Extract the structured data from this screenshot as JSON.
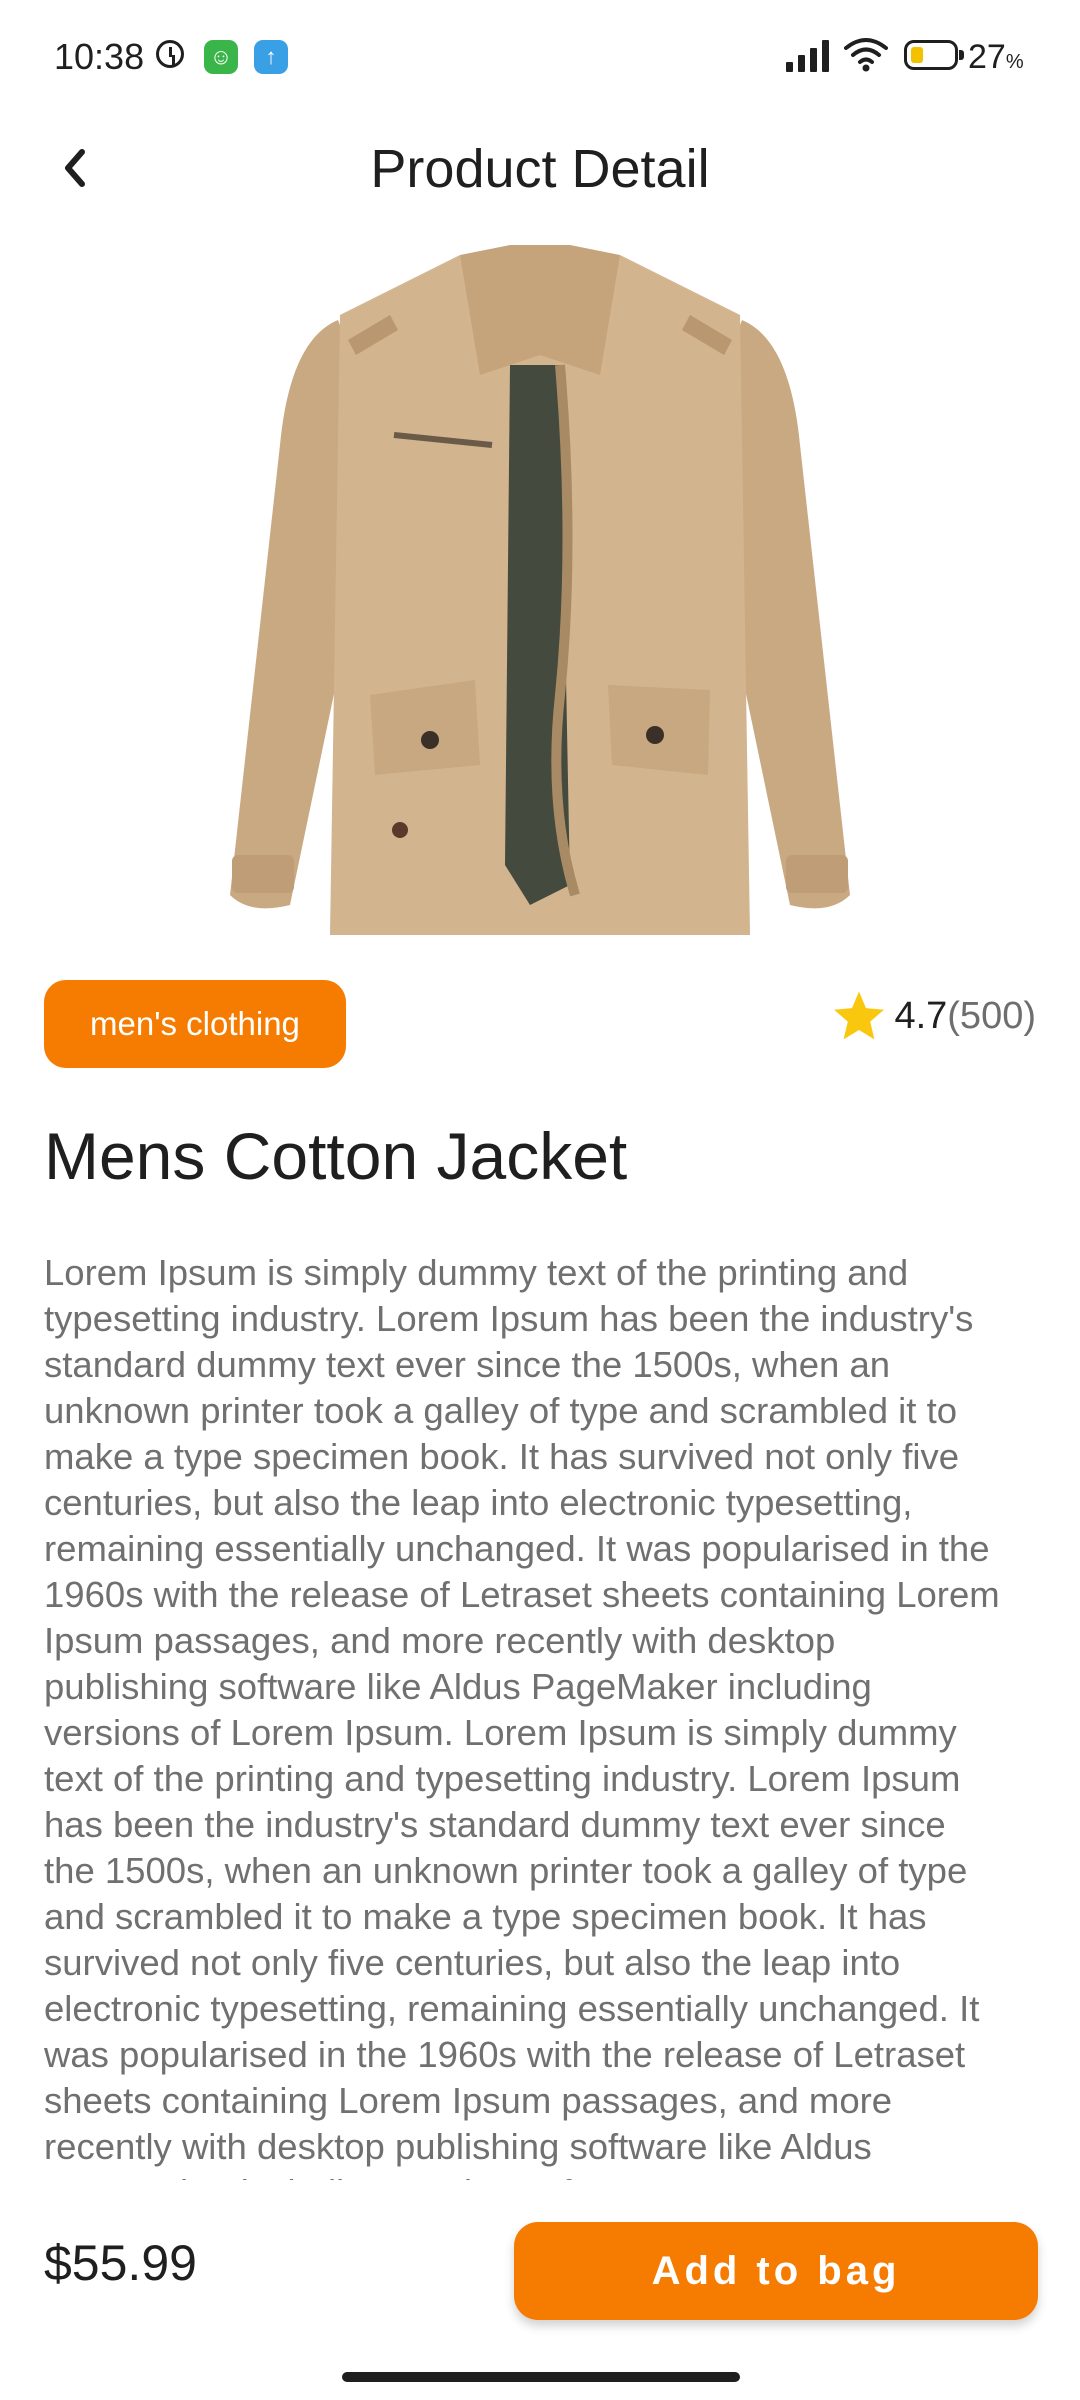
{
  "status_bar": {
    "time": "10:38",
    "battery_percent": "27",
    "battery_unit": "%",
    "icons": [
      "clock-icon",
      "app-notification-icon",
      "upload-icon",
      "signal-icon",
      "wifi-icon",
      "battery-icon"
    ]
  },
  "header": {
    "title": "Product Detail",
    "back_icon": "chevron-left-icon"
  },
  "product": {
    "image_alt": "khaki cotton jacket",
    "category": "men's clothing",
    "rating": "4.7",
    "rating_count": "(500)",
    "name": "Mens Cotton Jacket",
    "description": "Lorem Ipsum is simply dummy text of the printing and typesetting industry. Lorem Ipsum has been the industry's standard dummy text ever since the 1500s, when an unknown printer took a galley of type and scrambled it to make a type specimen book. It has survived not only five centuries, but also the leap into electronic typesetting, remaining essentially unchanged. It was popularised in the 1960s with the release of Letraset sheets containing Lorem Ipsum passages, and more recently with desktop publishing software like Aldus PageMaker including versions of Lorem Ipsum. Lorem Ipsum is simply dummy text of the printing and typesetting industry. Lorem Ipsum has been the industry's standard dummy text ever since the 1500s, when an unknown printer took a galley of type and scrambled it to make a type specimen book. It has survived not only five centuries, but also the leap into electronic typesetting, remaining essentially unchanged. It was popularised in the 1960s with the release of Letraset sheets containing Lorem Ipsum passages, and more recently with desktop publishing software like Aldus PageMaker including versions of Lorem Ipsum.",
    "price": "$55.99"
  },
  "actions": {
    "add_to_bag_label": "Add to bag"
  },
  "colors": {
    "accent": "#f57c00",
    "star": "#f9c80e",
    "text_primary": "#1f1f1f",
    "text_secondary": "#707070"
  }
}
